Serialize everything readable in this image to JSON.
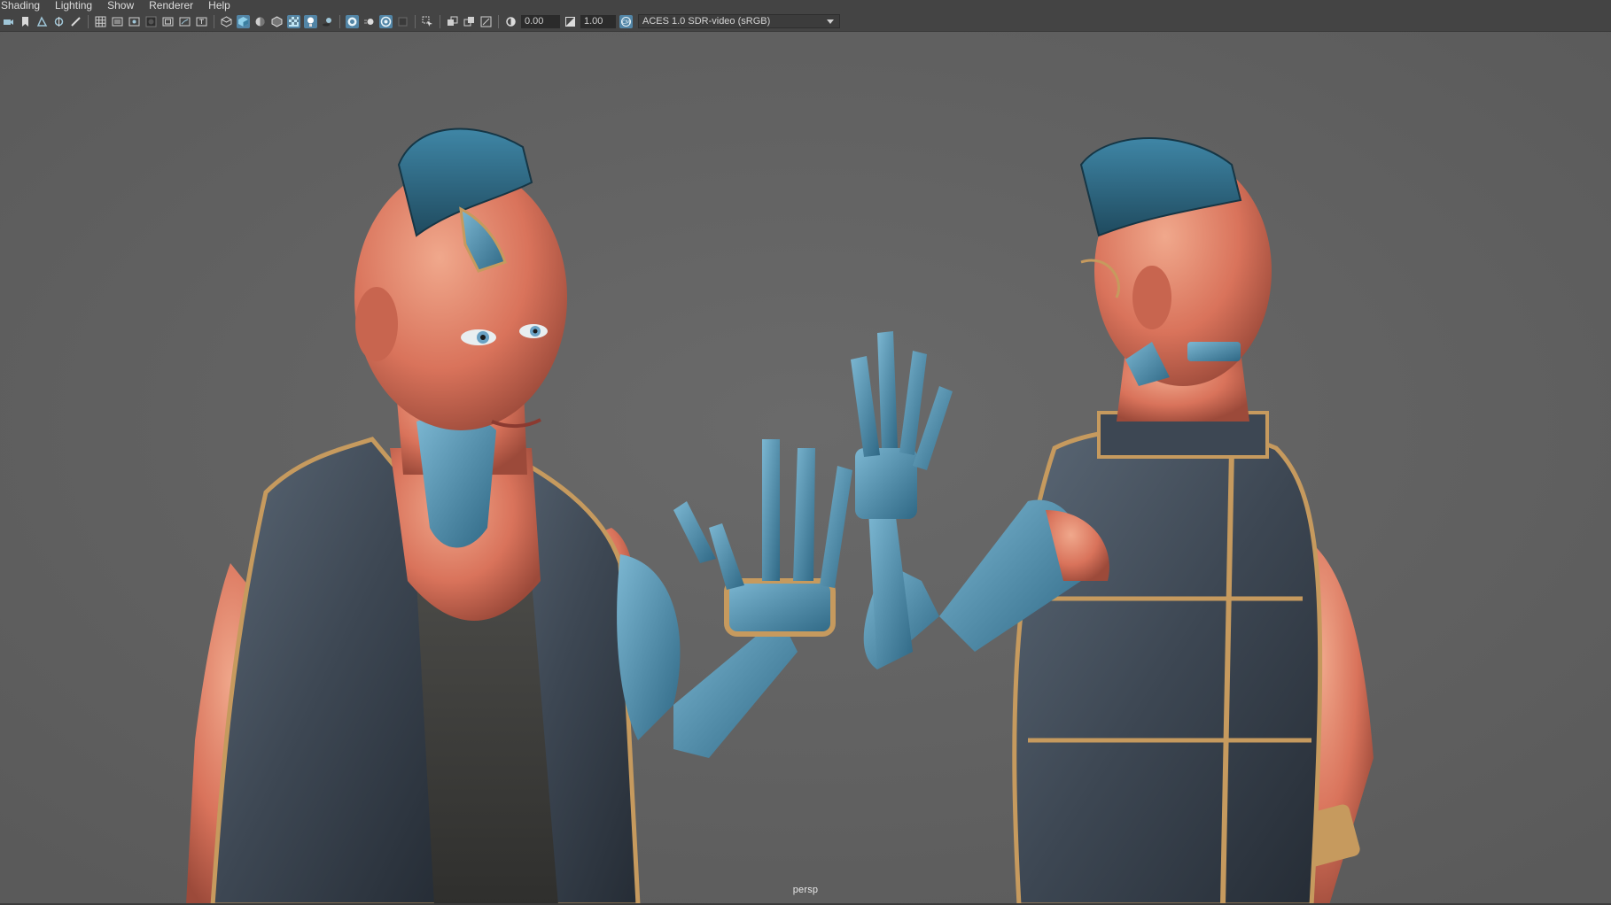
{
  "menubar": {
    "items": [
      "Shading",
      "Lighting",
      "Show",
      "Renderer",
      "Help"
    ]
  },
  "toolbar": {
    "exposure_value": "0.00",
    "gamma_value": "1.00",
    "color_space": "ACES 1.0 SDR-video (sRGB)",
    "icons": [
      "camera-select-icon",
      "bookmark-icon",
      "image-plane-icon",
      "camera-attributes-icon",
      "pen-icon",
      "grid-icon",
      "film-gate-icon",
      "resolution-gate-icon",
      "gate-mask-icon",
      "field-chart-icon",
      "safe-action-icon",
      "safe-title-icon",
      "wireframe-icon",
      "smooth-shade-icon",
      "default-material-icon",
      "wireframe-on-shaded-icon",
      "xray-icon",
      "lights-icon",
      "shadows-icon",
      "screen-space-ao-icon",
      "motion-blur-icon",
      "anti-aliasing-icon",
      "depth-of-field-icon",
      "isolate-select-icon",
      "xray-joints-icon",
      "xray-active-icon",
      "backface-icon",
      "exposure-icon",
      "gamma-icon",
      "color-management-icon"
    ]
  },
  "viewport": {
    "camera_name": "persp",
    "background_color": "#5f5f5f",
    "accent_color": "#4d8aa9",
    "trim_color": "#c69a5e"
  }
}
